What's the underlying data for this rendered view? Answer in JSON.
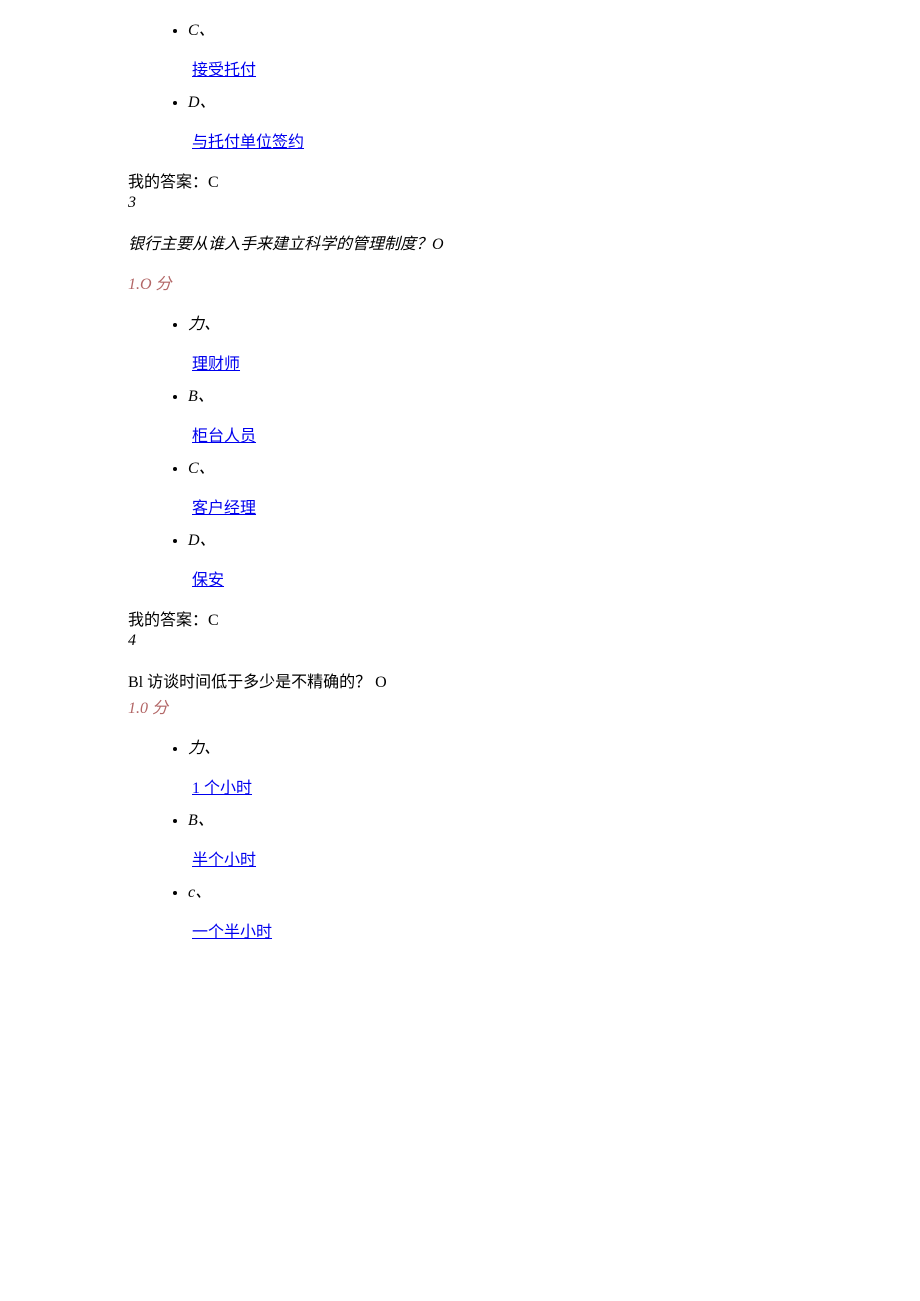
{
  "q2_partial": {
    "options": [
      {
        "marker": "C、",
        "text": "接受托付"
      },
      {
        "marker": "D、",
        "text": "与托付单位签约"
      }
    ],
    "answer_label": "我的答案：",
    "answer_value": "C"
  },
  "q3": {
    "number": "3",
    "question": "银行主要从谁入手来建立科学的管理制度？O",
    "score": "1.O 分",
    "options": [
      {
        "marker": "力、",
        "text": "理财师"
      },
      {
        "marker": "B、",
        "text": "柜台人员"
      },
      {
        "marker": "C、",
        "text": "客户经理"
      },
      {
        "marker": "D、",
        "text": "保安"
      }
    ],
    "answer_label": "我的答案：",
    "answer_value": "C"
  },
  "q4": {
    "number": "4",
    "question_prefix": "Bl 访谈时间低于多少是不精确的？",
    "question_suffix": "O",
    "score": "1.0 分",
    "options": [
      {
        "marker": "力、",
        "text": "1 个小时"
      },
      {
        "marker": "B、",
        "text": "半个小时"
      },
      {
        "marker": "c、",
        "text": "一个半小时"
      }
    ]
  }
}
